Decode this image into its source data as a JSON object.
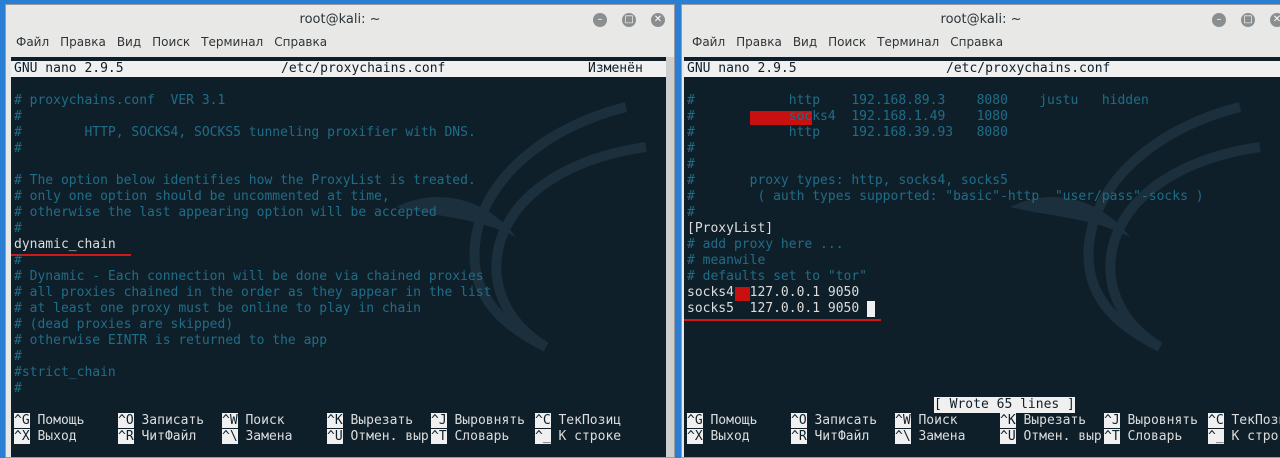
{
  "left": {
    "title": "root@kali: ~",
    "menu": [
      "Файл",
      "Правка",
      "Вид",
      "Поиск",
      "Терминал",
      "Справка"
    ],
    "nano_version": "GNU nano 2.9.5",
    "filename": "/etc/proxychains.conf",
    "modified": "Изменён",
    "lines": [
      "# proxychains.conf  VER 3.1",
      "#",
      "#        HTTP, SOCKS4, SOCKS5 tunneling proxifier with DNS.",
      "#",
      "",
      "# The option below identifies how the ProxyList is treated.",
      "# only one option should be uncommented at time,",
      "# otherwise the last appearing option will be accepted",
      "#",
      "dynamic_chain",
      "#",
      "# Dynamic - Each connection will be done via chained proxies",
      "# all proxies chained in the order as they appear in the list",
      "# at least one proxy must be online to play in chain",
      "# (dead proxies are skipped)",
      "# otherwise EINTR is returned to the app",
      "#",
      "#strict_chain",
      "#"
    ]
  },
  "right": {
    "title": "root@kali: ~",
    "menu": [
      "Файл",
      "Правка",
      "Вид",
      "Поиск",
      "Терминал",
      "Справка"
    ],
    "nano_version": "GNU nano 2.9.5",
    "filename": "/etc/proxychains.conf",
    "lines": [
      "#            http    192.168.89.3    8080    justu   hidden",
      "#            socks4  192.168.1.49    1080",
      "#            http    192.168.39.93   8080",
      "#",
      "#",
      "#       proxy types: http, socks4, socks5",
      "#        ( auth types supported: \"basic\"-http  \"user/pass\"-socks )",
      "#",
      "[ProxyList]",
      "# add proxy here ...",
      "# meanwile",
      "# defaults set to \"tor\"",
      "socks4  127.0.0.1 9050",
      "socks5  127.0.0.1 9050"
    ],
    "status": "[ Wrote 65 lines ]"
  },
  "shortcuts": {
    "row1": [
      {
        "key": "^G",
        "label": "Помощь"
      },
      {
        "key": "^O",
        "label": "Записать"
      },
      {
        "key": "^W",
        "label": "Поиск"
      },
      {
        "key": "^K",
        "label": "Вырезать"
      },
      {
        "key": "^J",
        "label": "Выровнять"
      },
      {
        "key": "^C",
        "label": "ТекПозиц"
      }
    ],
    "row2": [
      {
        "key": "^X",
        "label": "Выход"
      },
      {
        "key": "^R",
        "label": "ЧитФайл"
      },
      {
        "key": "^\\",
        "label": "Замена"
      },
      {
        "key": "^U",
        "label": "Отмен. выр"
      },
      {
        "key": "^T",
        "label": "Словарь"
      },
      {
        "key": "^_",
        "label": "К строке"
      }
    ]
  },
  "colors": {
    "terminal_bg": "#0f1f2a",
    "comment": "#1f6d87",
    "text": "#dcdcdc",
    "highlight_red": "#d01818"
  }
}
